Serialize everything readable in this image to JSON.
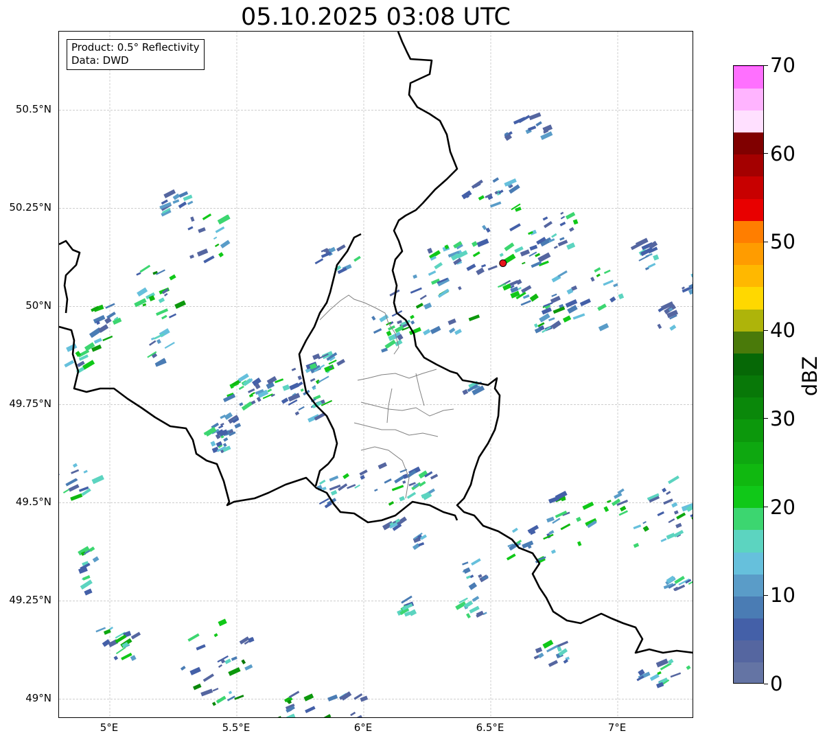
{
  "title": "05.10.2025 03:08 UTC",
  "info": {
    "product": "Product: 0.5° Reflectivity",
    "data": "Data: DWD"
  },
  "map": {
    "lon_range": [
      4.8,
      7.3
    ],
    "lat_range": [
      48.95,
      50.7
    ],
    "lat_ticks": [
      {
        "value": 50.5,
        "label": "50.5°N"
      },
      {
        "value": 50.25,
        "label": "50.25°N"
      },
      {
        "value": 50.0,
        "label": "50°N"
      },
      {
        "value": 49.75,
        "label": "49.75°N"
      },
      {
        "value": 49.5,
        "label": "49.5°N"
      },
      {
        "value": 49.25,
        "label": "49.25°N"
      },
      {
        "value": 49.0,
        "label": "49°N"
      }
    ],
    "lon_ticks": [
      {
        "value": 5.0,
        "label": "5°E"
      },
      {
        "value": 5.5,
        "label": "5.5°E"
      },
      {
        "value": 6.0,
        "label": "6°E"
      },
      {
        "value": 6.5,
        "label": "6.5°E"
      },
      {
        "value": 7.0,
        "label": "7°E"
      }
    ],
    "grid": true,
    "radar_site": {
      "lon": 6.548,
      "lat": 50.11,
      "color": "#e8161b"
    }
  },
  "colorbar": {
    "unit": "dBZ",
    "min": 0,
    "max": 70,
    "step": 2.5,
    "ticks": [
      {
        "value": 0,
        "label": "0"
      },
      {
        "value": 10,
        "label": "10"
      },
      {
        "value": 20,
        "label": "20"
      },
      {
        "value": 30,
        "label": "30"
      },
      {
        "value": 40,
        "label": "40"
      },
      {
        "value": 50,
        "label": "50"
      },
      {
        "value": 60,
        "label": "60"
      },
      {
        "value": 70,
        "label": "70"
      }
    ],
    "colors": [
      "#6474a4",
      "#5566a0",
      "#4460a8",
      "#4a7cb4",
      "#5a9cc8",
      "#66c0dc",
      "#5cd4c0",
      "#3cd670",
      "#10c818",
      "#10b810",
      "#0ea810",
      "#0c980c",
      "#0a880a",
      "#087808",
      "#066806",
      "#4a7a0a",
      "#aeb40a",
      "#ffd800",
      "#ffb800",
      "#ff9c00",
      "#ff7e00",
      "#e80000",
      "#c80000",
      "#a40000",
      "#800000",
      "#ffe0ff",
      "#ffb4ff",
      "#ff70ff",
      "#ee38ee"
    ]
  },
  "borders_color": "#000000",
  "subborders_color": "#808080"
}
